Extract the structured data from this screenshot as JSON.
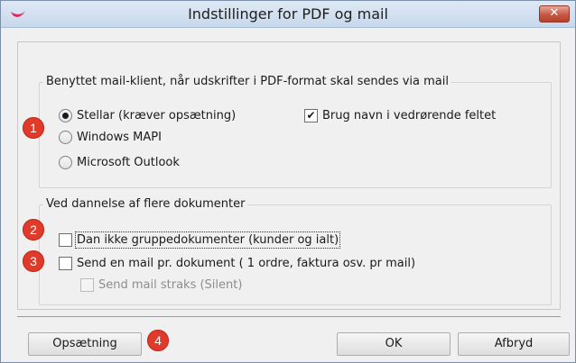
{
  "window": {
    "title": "Indstillinger for PDF og mail",
    "close_glyph": "✕",
    "app_icon": "app-logo-icon"
  },
  "group_mail_client": {
    "legend": "Benyttet mail-klient, når udskrifter i PDF-format skal sendes via mail",
    "options": [
      {
        "label": "Stellar (kræver opsætning)",
        "selected": true
      },
      {
        "label": "Windows MAPI",
        "selected": false
      },
      {
        "label": "Microsoft Outlook",
        "selected": false
      }
    ],
    "use_name_checkbox": {
      "label": "Brug navn i vedrørende feltet",
      "checked": true,
      "glyph": "✔"
    }
  },
  "group_documents": {
    "legend": "Ved dannelse af flere dokumenter",
    "no_group_docs": {
      "label": "Dan ikke gruppedokumenter (kunder og ialt)",
      "checked": false
    },
    "send_per_doc": {
      "label": "Send en mail pr. dokument ( 1 ordre, faktura osv. pr mail)",
      "checked": false
    },
    "send_immediately": {
      "label": "Send mail straks (Silent)",
      "checked": false,
      "enabled": false
    }
  },
  "badges": [
    "1",
    "2",
    "3",
    "4"
  ],
  "buttons": {
    "setup": "Opsætning",
    "ok": "OK",
    "cancel": "Afbryd"
  },
  "colors": {
    "badge": "#e03a2a",
    "close_button": "#c75842",
    "titlebar": "#c7d8ec"
  }
}
